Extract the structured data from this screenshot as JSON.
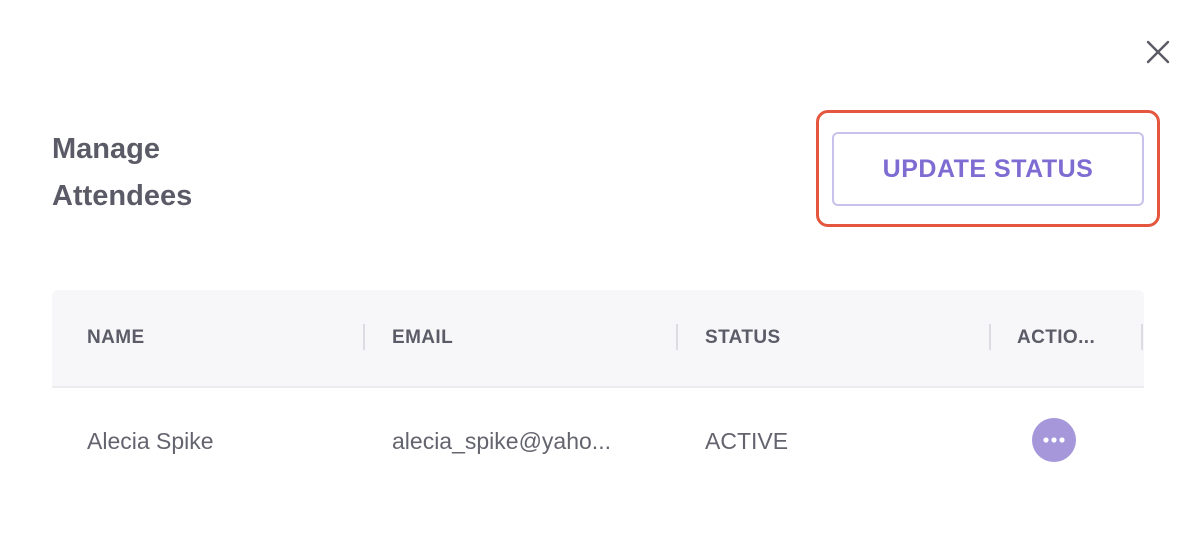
{
  "dialog": {
    "title": "Manage\nAttendees",
    "title_line1": "Manage",
    "title_line2": "Attendees",
    "update_status_label": "UPDATE STATUS",
    "close_icon": "close-icon"
  },
  "colors": {
    "accent": "#7e6cd3",
    "button_border": "#c9c1ec",
    "highlight": "#e4573e",
    "more_button_bg": "#a697db"
  },
  "table": {
    "columns": [
      "NAME",
      "EMAIL",
      "STATUS",
      "ACTIO..."
    ],
    "rows": [
      {
        "name": "Alecia Spike",
        "email": "alecia_spike@yaho...",
        "status": "ACTIVE",
        "action_icon": "more-horizontal-icon"
      }
    ]
  }
}
